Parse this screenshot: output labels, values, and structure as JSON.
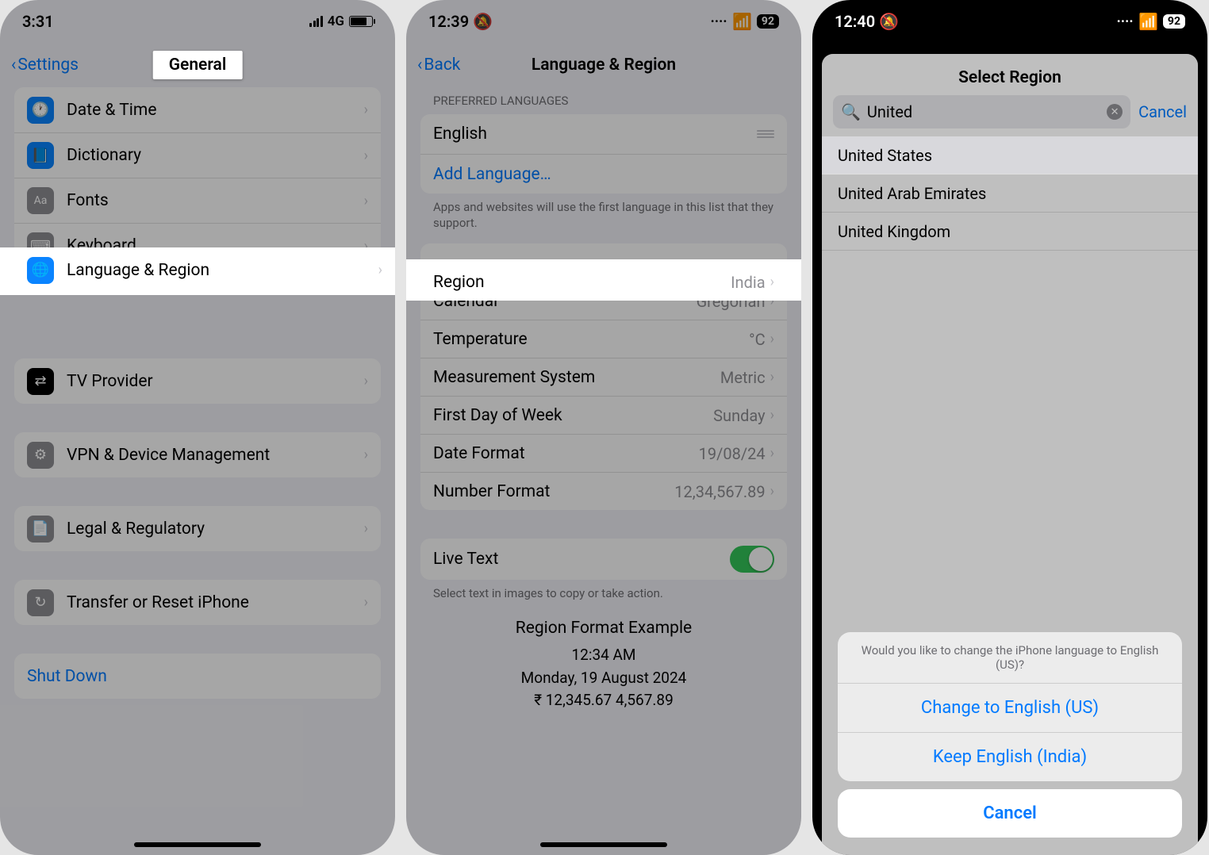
{
  "p1": {
    "time": "3:31",
    "network": "4G",
    "back_label": "Settings",
    "title": "General",
    "rows": {
      "date_time": "Date & Time",
      "dictionary": "Dictionary",
      "fonts": "Fonts",
      "keyboard": "Keyboard",
      "lang_region": "Language & Region",
      "tv_provider": "TV Provider",
      "vpn": "VPN & Device Management",
      "legal": "Legal & Regulatory",
      "transfer": "Transfer or Reset iPhone",
      "shutdown": "Shut Down"
    }
  },
  "p2": {
    "time": "12:39",
    "batt": "92",
    "back_label": "Back",
    "title": "Language & Region",
    "pref_hdr": "PREFERRED LANGUAGES",
    "lang_en": "English",
    "add_lang": "Add Language…",
    "lang_ftr": "Apps and websites will use the first language in this list that they support.",
    "rows": {
      "region_l": "Region",
      "region_v": "India",
      "cal_l": "Calendar",
      "cal_v": "Gregorian",
      "temp_l": "Temperature",
      "temp_v": "°C",
      "meas_l": "Measurement System",
      "meas_v": "Metric",
      "fdow_l": "First Day of Week",
      "fdow_v": "Sunday",
      "datef_l": "Date Format",
      "datef_v": "19/08/24",
      "numf_l": "Number Format",
      "numf_v": "12,34,567.89"
    },
    "live_text": "Live Text",
    "live_ftr": "Select text in images to copy or take action.",
    "fmt_title": "Region Format Example",
    "fmt_time": "12:34 AM",
    "fmt_date": "Monday, 19 August 2024",
    "fmt_nums": "₹ 12,345.67    4,567.89"
  },
  "p3": {
    "time": "12:40",
    "batt": "92",
    "sheet_title": "Select Region",
    "search_value": "United",
    "cancel": "Cancel",
    "results": {
      "r1": "United States",
      "r2": "United Arab Emirates",
      "r3": "United Kingdom"
    },
    "alert_msg": "Would you like to change the iPhone language to English (US)?",
    "alert_b1": "Change to English (US)",
    "alert_b2": "Keep English (India)",
    "alert_cancel": "Cancel"
  }
}
